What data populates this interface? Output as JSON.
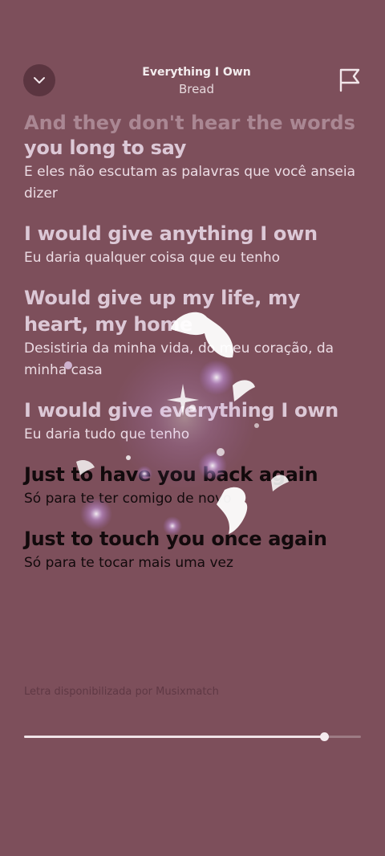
{
  "header": {
    "title": "Everything I Own",
    "artist": "Bread",
    "collapse_icon": "chevron-down-icon",
    "report_icon": "flag-icon"
  },
  "lyrics": {
    "faded_line": "And they don't hear the words",
    "lines": [
      {
        "text": "you long to say",
        "translation": "E eles não escutam as palavras que você anseia dizer",
        "state": "past"
      },
      {
        "text": "I would give anything I own",
        "translation": "Eu daria qualquer coisa que eu tenho",
        "state": "past"
      },
      {
        "text": "Would give up my life, my heart, my home",
        "translation": "Desistiria da minha vida, do meu coração, da minha casa",
        "state": "past"
      },
      {
        "text": "I would give everything I own",
        "translation": "Eu daria tudo que tenho",
        "state": "past"
      },
      {
        "text": "Just to have you back again",
        "translation": "Só para te ter comigo de novo",
        "state": "current"
      },
      {
        "text": "Just to touch you once again",
        "translation": "Só para te tocar mais uma vez",
        "state": "current"
      }
    ]
  },
  "footer": {
    "credit": "Letra disponibilizada por Musixmatch"
  },
  "progress": {
    "fraction": 0.89
  },
  "colors": {
    "background": "#7d4f5b",
    "past_lyric": "#dcc8d6",
    "current_lyric": "#120a0c"
  }
}
